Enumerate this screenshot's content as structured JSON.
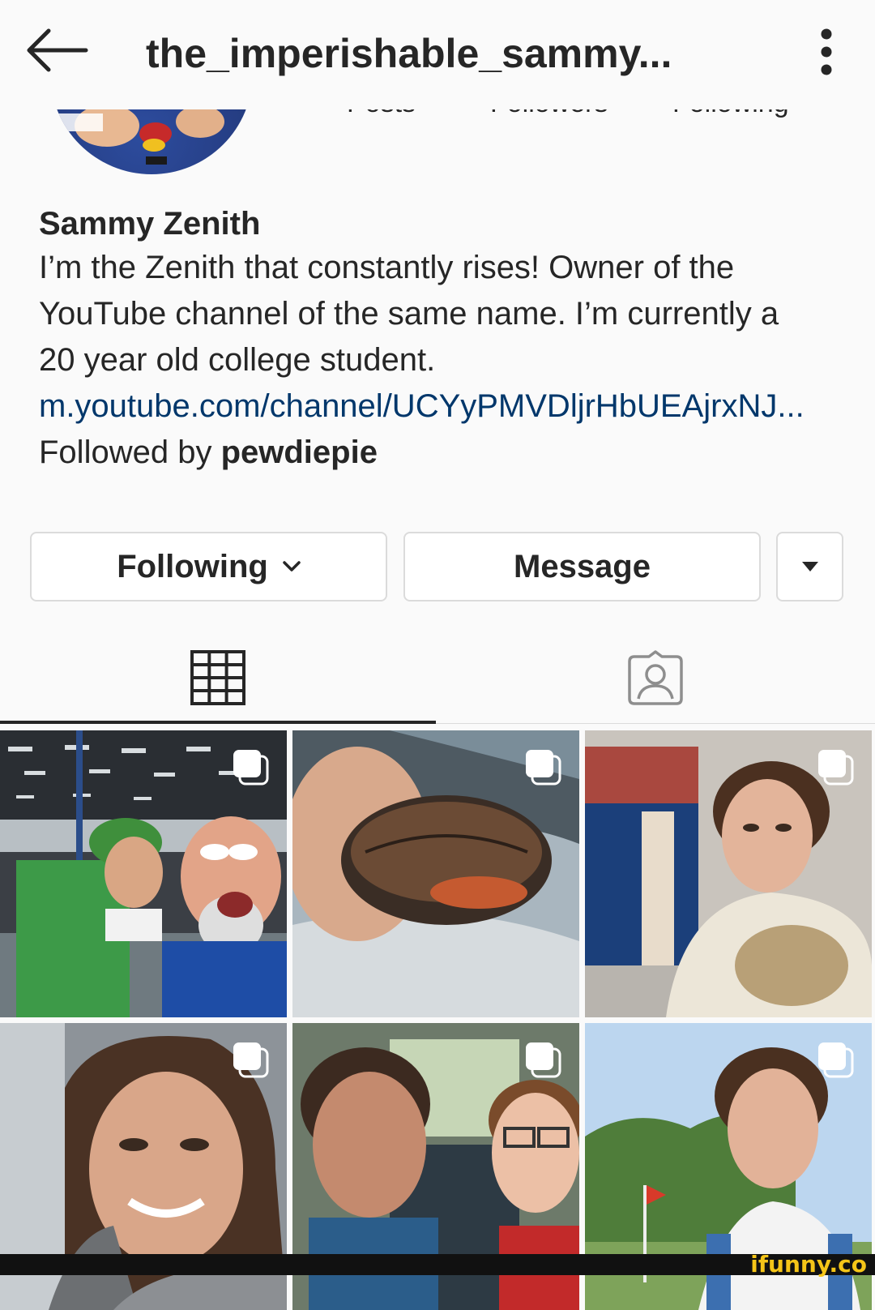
{
  "header": {
    "username": "the_imperishable_sammy...",
    "back_icon": "arrow-left-icon",
    "menu_icon": "vertical-dots-icon"
  },
  "stats_labels": [
    "Posts",
    "Followers",
    "Following"
  ],
  "profile": {
    "name": "Sammy Zenith",
    "bio_lines": [
      "I’m the Zenith that constantly rises! Owner of the",
      "YouTube channel of the same name. I’m currently a",
      "20 year old college student."
    ],
    "link": "m.youtube.com/channel/UCYyPMVDljrHbUEAjrxNJ...",
    "followed_by_prefix": "Followed by ",
    "followed_by_user": "pewdiepie"
  },
  "actions": {
    "following_label": "Following",
    "message_label": "Message"
  },
  "tabs": [
    {
      "name": "posts-grid",
      "icon": "grid-icon",
      "active": true
    },
    {
      "name": "tagged",
      "icon": "tagged-person-icon",
      "active": false
    }
  ],
  "grid_posts": [
    {
      "subject": "convention selfie",
      "multi": true
    },
    {
      "subject": "turtle in hand",
      "multi": true
    },
    {
      "subject": "selfie outside building",
      "multi": true
    },
    {
      "subject": "car selfie",
      "multi": true
    },
    {
      "subject": "bus selfie",
      "multi": true
    },
    {
      "subject": "park selfie",
      "multi": true
    }
  ],
  "colors": {
    "background": "#fafafa",
    "text": "#262626",
    "link": "#00376b",
    "border": "#dbdbdb",
    "watermark": "#f5c518"
  },
  "watermark": "ifunny.co"
}
